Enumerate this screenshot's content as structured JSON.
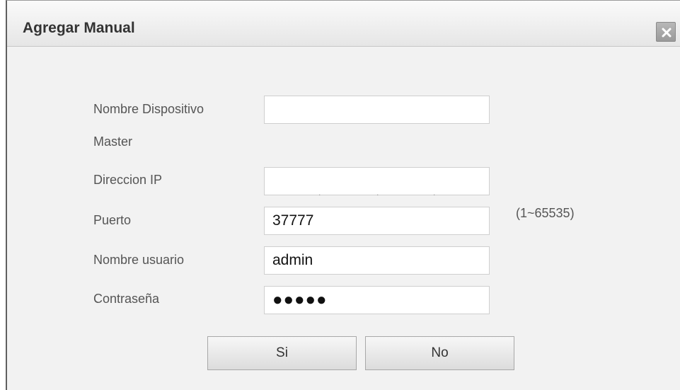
{
  "dialog": {
    "title": "Agregar Manual",
    "close_icon": "close-icon"
  },
  "form": {
    "device_name": {
      "label": "Nombre Dispositivo",
      "value": ""
    },
    "master_label": "Master",
    "ip_address": {
      "label": "Direccion IP",
      "separators": [
        ".",
        ".",
        "."
      ]
    },
    "port": {
      "label": "Puerto",
      "value": "37777",
      "range": "(1~65535)"
    },
    "username": {
      "label": "Nombre usuario",
      "value": "admin"
    },
    "password": {
      "label": "Contraseña",
      "masked_value": "●●●●●"
    }
  },
  "buttons": {
    "yes": "Si",
    "no": "No"
  }
}
